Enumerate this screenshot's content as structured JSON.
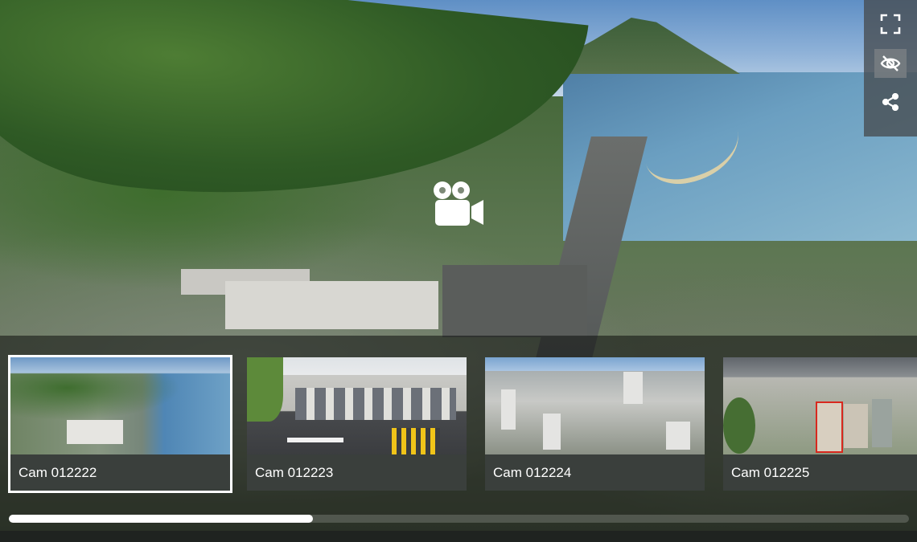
{
  "toolbar": {
    "buttons": [
      {
        "name": "fullscreen",
        "icon": "fullscreen-icon",
        "active": false
      },
      {
        "name": "hide",
        "icon": "eye-off-icon",
        "active": true
      },
      {
        "name": "share",
        "icon": "share-icon",
        "active": false
      }
    ]
  },
  "center": {
    "icon": "video-camera-icon"
  },
  "cameras": [
    {
      "label": "Cam 012222",
      "selected": true
    },
    {
      "label": "Cam 012223",
      "selected": false
    },
    {
      "label": "Cam 012224",
      "selected": false
    },
    {
      "label": "Cam 012225",
      "selected": false
    }
  ],
  "scroll": {
    "position_fraction": 0.0,
    "visible_fraction": 0.34
  },
  "colors": {
    "icon": "#ffffff",
    "selected_outline": "#ffffff",
    "toolbar_bg": "#464c50"
  }
}
